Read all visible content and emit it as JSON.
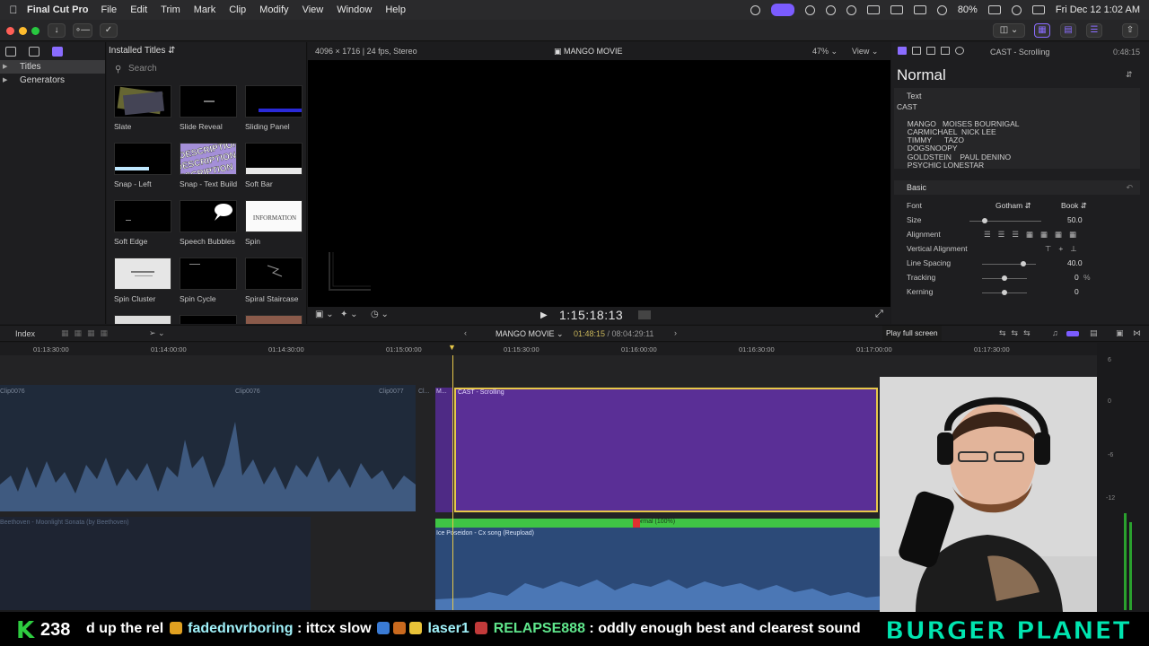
{
  "menubar": {
    "app": "Final Cut Pro",
    "items": [
      "File",
      "Edit",
      "Trim",
      "Mark",
      "Clip",
      "Modify",
      "View",
      "Window",
      "Help"
    ],
    "battery": "80%",
    "datetime": "Fri Dec 12  1:02 AM"
  },
  "library": {
    "items": [
      {
        "label": "Titles",
        "selected": true
      },
      {
        "label": "Generators",
        "selected": false
      }
    ]
  },
  "titles_browser": {
    "header": "Installed Titles",
    "search_placeholder": "Search",
    "tiles": [
      "Slate",
      "Slide Reveal",
      "Sliding Panel",
      "Snap - Left",
      "Snap - Text Build",
      "Soft Bar",
      "Soft Edge",
      "Speech Bubbles",
      "Spin",
      "Spin Cluster",
      "Spin Cycle",
      "Spiral Staircase"
    ],
    "thumb_text": {
      "description": "DESCRIPTION",
      "information": "INFORMATION"
    }
  },
  "viewer": {
    "format": "4096 × 1716 | 24 fps, Stereo",
    "project": "MANGO MOVIE",
    "zoom": "47%",
    "view": "View",
    "timecode": "1:15:18:13"
  },
  "inspector": {
    "clip_name": "CAST - Scrolling",
    "duration": "0:48:15",
    "preset": "Normal",
    "text_section": "Text",
    "text_body": "CAST\n\n     MANGO   MOISES BOURNIGAL\n     CARMICHAEL  NICK LEE\n     TIMMY      TAZO\n     DOGSNOOPY\n     GOLDSTEIN    PAUL DENINO\n     PSYCHIC LONESTAR",
    "basic_section": "Basic",
    "props": [
      {
        "label": "Font",
        "value": "Gotham",
        "value2": "Book"
      },
      {
        "label": "Size",
        "value": "50.0"
      },
      {
        "label": "Alignment",
        "value": ""
      },
      {
        "label": "Vertical Alignment",
        "value": ""
      },
      {
        "label": "Line Spacing",
        "value": "40.0"
      },
      {
        "label": "Tracking",
        "value": "0",
        "unit": "%"
      },
      {
        "label": "Kerning",
        "value": "0"
      }
    ]
  },
  "timeline_bar": {
    "index": "Index",
    "project": "MANGO MOVIE",
    "position": "01:48:15",
    "total": " / 08:04:29:11",
    "tooltip": "Play full screen"
  },
  "ruler": [
    "01:13:30:00",
    "01:14:00:00",
    "01:14:30:00",
    "01:15:00:00",
    "01:15:30:00",
    "01:16:00:00",
    "01:16:30:00",
    "01:17:00:00",
    "01:17:30:00"
  ],
  "clips": {
    "primary_labels": [
      "Clip0076",
      "Clip0076",
      "Clip0077",
      "Cl..."
    ],
    "pre_title": "M...",
    "title_clip": "CAST - Scrolling",
    "bg_music": "Beethoven - Moonlight Sonata (by Beethoven)",
    "green_bar": "Normal (100%)",
    "audio_clip": "Ice Poseidon - Cx song (Reupload)"
  },
  "meters": [
    "6",
    "0",
    "-6",
    "-12"
  ],
  "ticker": {
    "count": "238",
    "fragment": "d up the rel",
    "user1": "fadednvrboring",
    "msg1": ": ittcx slow",
    "user2": "laser1",
    "user3": "RELAPSE888",
    "msg3": ": oddly enough best and clearest sound",
    "brand": "BURGER PLANET"
  },
  "colors": {
    "accent": "#8a6cff",
    "title_clip": "#5a2f96",
    "selection": "#e7c84a",
    "audio_bar": "#3fc445",
    "audio_clip": "#2c4a78"
  }
}
